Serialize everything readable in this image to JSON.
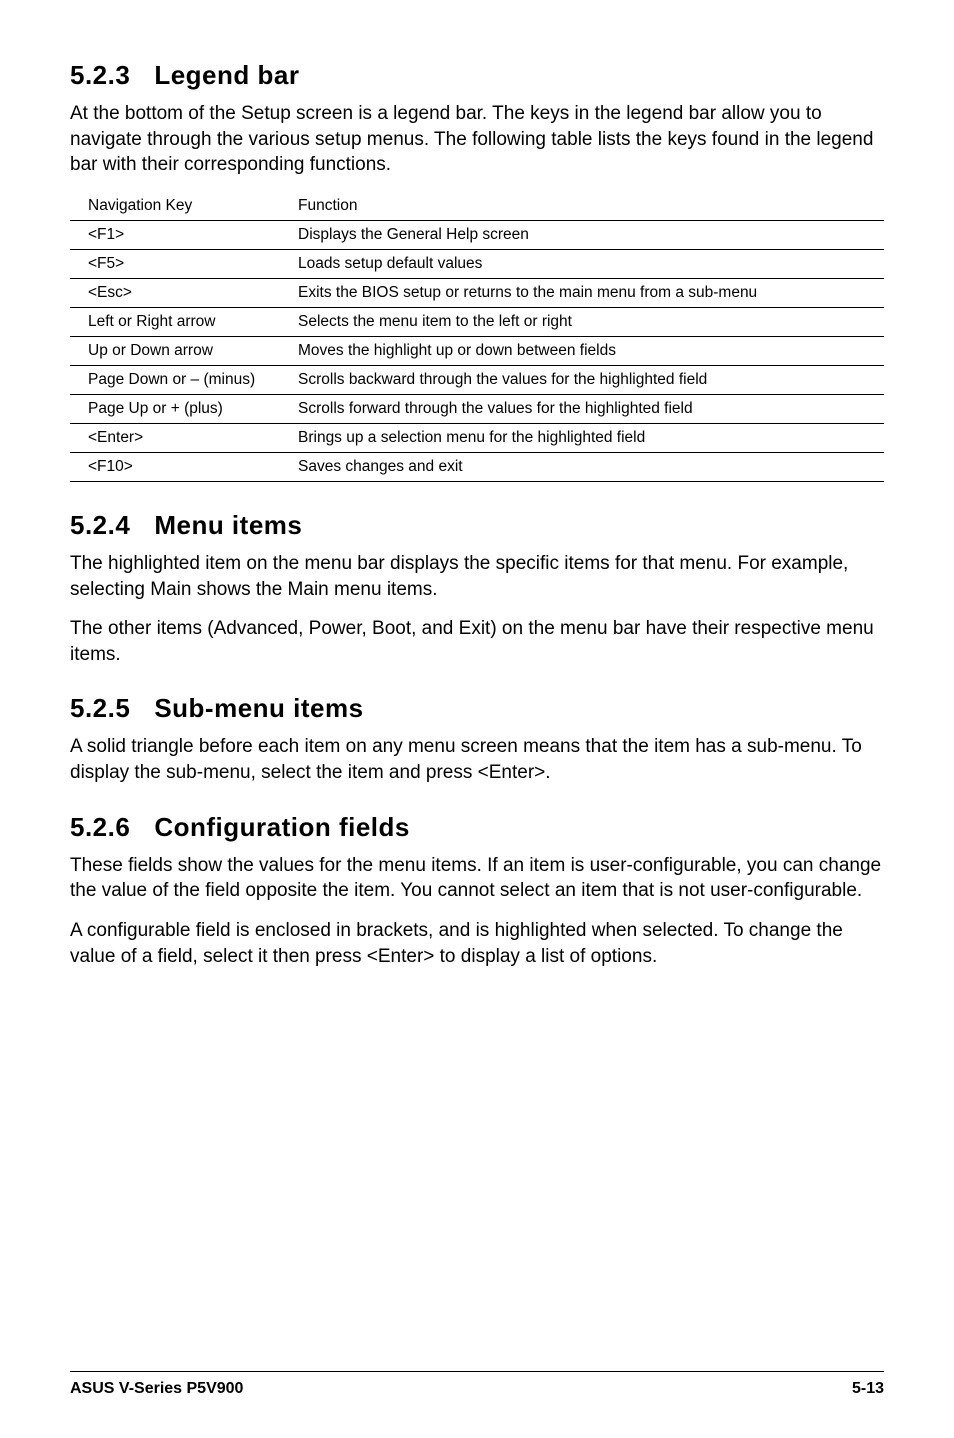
{
  "sections": {
    "s523": {
      "num": "5.2.3",
      "title": "Legend bar",
      "p1": "At the bottom of the Setup screen is a legend bar. The keys in the legend bar allow you to navigate through the various setup menus. The following table lists the keys found in the legend bar with their corresponding functions."
    },
    "s524": {
      "num": "5.2.4",
      "title": "Menu items",
      "p1": "The highlighted item on the menu bar  displays the specific items for that menu. For example, selecting Main shows the Main menu items.",
      "p2": "The other items (Advanced, Power, Boot, and Exit) on the menu bar have their respective menu items."
    },
    "s525": {
      "num": "5.2.5",
      "title": "Sub-menu items",
      "p1": "A solid triangle before each item on any menu screen means that the item has a sub-menu. To display the sub-menu, select the item and press <Enter>."
    },
    "s526": {
      "num": "5.2.6",
      "title": "Configuration fields",
      "p1": "These fields show the values for the menu items. If an item is user-configurable, you can change the value of the field opposite the item. You cannot select an item that is not user-configurable.",
      "p2": "A configurable field is enclosed in brackets, and is highlighted when selected. To change the value of a field, select it then press <Enter> to display a list of options."
    }
  },
  "table": {
    "header": {
      "col1": "Navigation Key",
      "col2": "Function"
    },
    "rows": [
      {
        "key": "<F1>",
        "func": "Displays the General Help screen"
      },
      {
        "key": "<F5>",
        "func": "Loads setup default values"
      },
      {
        "key": "<Esc>",
        "func": "Exits the BIOS setup or returns to the main menu from a sub-menu"
      },
      {
        "key": "Left or Right arrow",
        "func": "Selects the menu item to the left or right"
      },
      {
        "key": "Up or Down arrow",
        "func": "Moves the highlight up or down between fields"
      },
      {
        "key": "Page Down or – (minus)",
        "func": "Scrolls backward through the values for the highlighted field"
      },
      {
        "key": "Page Up or + (plus)",
        "func": "Scrolls forward through the values for the highlighted field"
      },
      {
        "key": "<Enter>",
        "func": "Brings up a selection menu for the highlighted field"
      },
      {
        "key": "<F10>",
        "func": "Saves changes and exit"
      }
    ]
  },
  "footer": {
    "left": "ASUS V-Series P5V900",
    "right": "5-13"
  }
}
